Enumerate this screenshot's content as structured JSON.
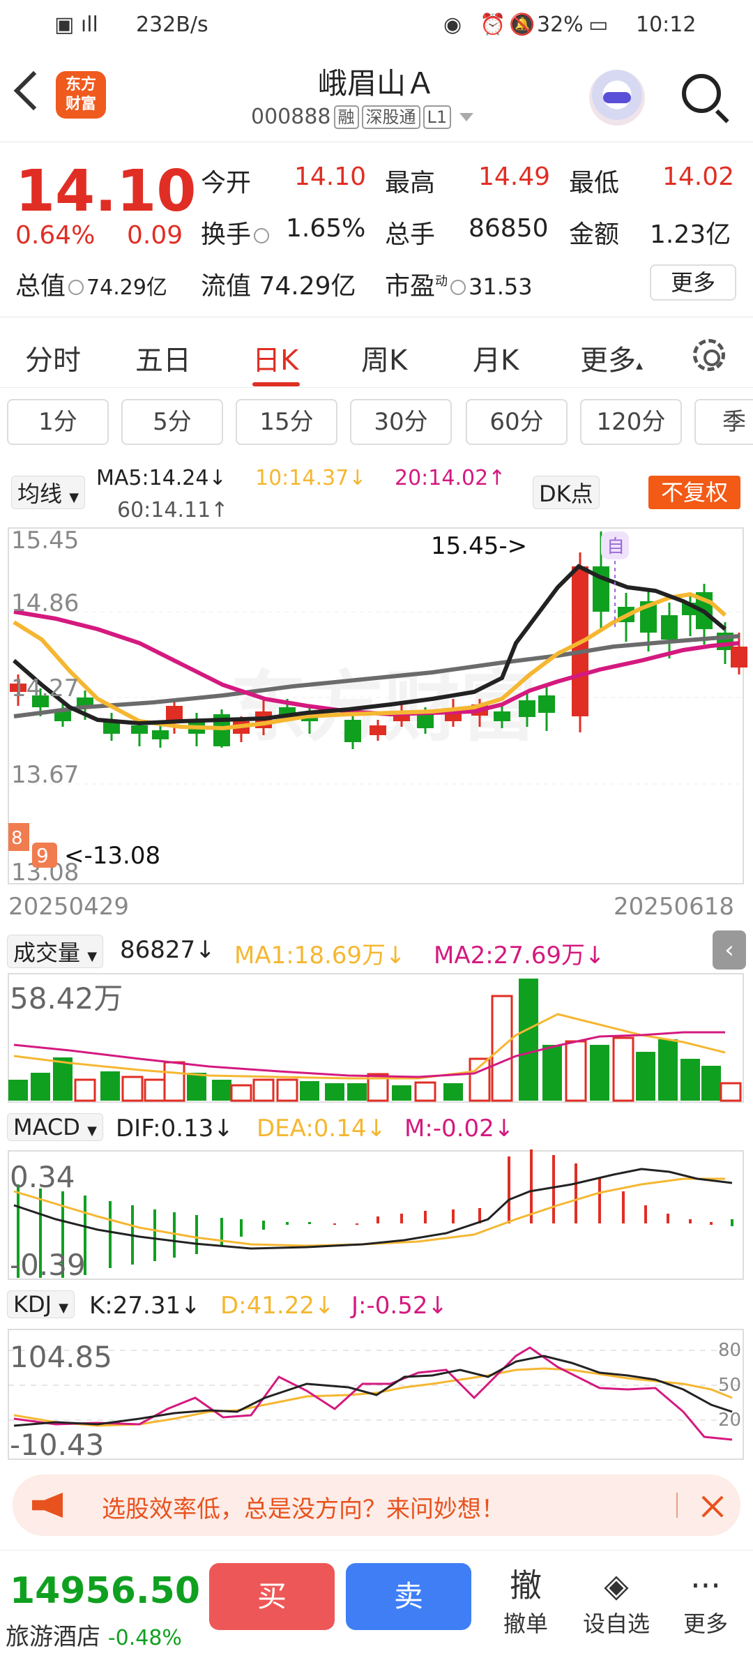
{
  "status_bar": {
    "network": "232B/s",
    "battery": "32%",
    "time": "10:12"
  },
  "header": {
    "logo_line1": "东方",
    "logo_line2": "财富",
    "stock_name": "峨眉山Ａ",
    "stock_code": "000888",
    "tag_margin": "融",
    "tag_connect": "深股通",
    "tag_level": "L1"
  },
  "quote": {
    "price": "14.10",
    "change_pct": "0.64%",
    "change": "0.09",
    "open_label": "今开",
    "open": "14.10",
    "high_label": "最高",
    "high": "14.49",
    "low_label": "最低",
    "low": "14.02",
    "turnover_label": "换手",
    "turnover": "1.65%",
    "volume_label": "总手",
    "volume": "86850",
    "amount_label": "金额",
    "amount": "1.23亿",
    "mktcap_label": "总值",
    "mktcap": "74.29亿",
    "float_label": "流值",
    "float_cap": "74.29亿",
    "pe_label": "市盈",
    "pe_sup": "动",
    "pe": "31.53",
    "more": "更多"
  },
  "tabs": [
    "分时",
    "五日",
    "日K",
    "周K",
    "月K",
    "更多"
  ],
  "active_tab": "日K",
  "periods": [
    "1分",
    "5分",
    "15分",
    "30分",
    "60分",
    "120分",
    "季"
  ],
  "ma_header": {
    "selector": "均线",
    "ma5": "MA5:14.24↓",
    "ma10": "10:14.37↓",
    "ma20": "20:14.02↑",
    "ma60": "60:14.11↑",
    "dk": "DK点",
    "adjust": "不复权"
  },
  "kline": {
    "y_labels": [
      "15.45",
      "14.86",
      "14.27",
      "13.67",
      "13.08"
    ],
    "max_marker": "15.45->",
    "min_marker": "<-13.08",
    "date_start": "20250429",
    "date_end": "20250618",
    "marker_zi": "自",
    "badge_8": "8",
    "badge_9": "9",
    "watermark": "东方财富"
  },
  "volume_header": {
    "selector": "成交量",
    "value": "86827↓",
    "ma1": "MA1:18.69万↓",
    "ma2": "MA2:27.69万↓",
    "max_label": "58.42万"
  },
  "macd_header": {
    "selector": "MACD",
    "dif": "DIF:0.13↓",
    "dea": "DEA:0.14↓",
    "m": "M:-0.02↓",
    "max_label": "0.34",
    "min_label": "-0.39"
  },
  "kdj_header": {
    "selector": "KDJ",
    "k": "K:27.31↓",
    "d": "D:41.22↓",
    "j": "J:-0.52↓",
    "max_label": "104.85",
    "min_label": "-10.43",
    "ref_80": "80",
    "ref_50": "50",
    "ref_20": "20"
  },
  "promo": {
    "text": "选股效率低，总是没方向？来问妙想！"
  },
  "bottom": {
    "index_value": "14956.50",
    "index_name": "旅游酒店",
    "index_change": "-0.48%",
    "buy": "买",
    "sell": "卖",
    "cancel_icon": "撤",
    "cancel": "撤单",
    "watch": "设自选",
    "more": "更多"
  },
  "colors": {
    "up": "#e02e24",
    "down": "#10a020",
    "ma5": "#222222",
    "ma10": "#f5b731",
    "ma20": "#d4197f",
    "ma60": "#6b6b6b",
    "accent": "#ef5a1f"
  }
}
